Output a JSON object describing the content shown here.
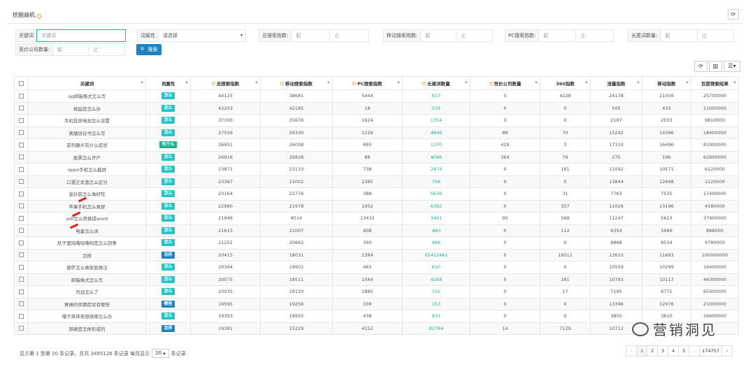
{
  "header": {
    "title": "挖掘商机",
    "hint_glyph": "?",
    "refresh_glyph": "⟳"
  },
  "filters": {
    "keyword": {
      "label": "关键词",
      "placeholder": "关键词"
    },
    "attr": {
      "label": "词属性",
      "value": "请选择",
      "caret": "▾"
    },
    "total": {
      "label": "总搜索指数:",
      "from": "起",
      "to": "止"
    },
    "mobile": {
      "label": "移动搜索指数:",
      "from": "起",
      "to": "止"
    },
    "pc": {
      "label": "PC搜索指数:",
      "from": "起",
      "to": "止"
    },
    "longtail": {
      "label": "长尾词数量:",
      "from": "起",
      "to": "止"
    },
    "bid": {
      "label": "竞价公司数量:",
      "from": "起",
      "to": "止"
    },
    "search_button": "🔍 搜索"
  },
  "toolbar": {
    "refresh": "⟳",
    "columns": "▥",
    "export": "☰▾"
  },
  "columns": [
    "关键词",
    "词属性",
    "总搜索指数",
    "移动搜索指数",
    "PC搜索指数",
    "长尾词数量",
    "竞价公司数量",
    "360指数",
    "流量指数",
    "移动指数",
    "百度搜索结果"
  ],
  "rows": [
    {
      "kw": "qq邮箱格式怎么写",
      "tag": "怎么",
      "tc": "c1",
      "total": "44125",
      "mobile": "38681",
      "pc": "5444",
      "lt": "817",
      "bid": "0",
      "s360": "4228",
      "flow": "24178",
      "mi": "21056",
      "baidu": "25700000"
    },
    {
      "kw": "拖延症怎么办",
      "tag": "怎么",
      "tc": "c1",
      "total": "42203",
      "mobile": "42185",
      "pc": "18",
      "lt": "534",
      "bid": "0",
      "s360": "0",
      "flow": "505",
      "mi": "433",
      "baidu": "11000000"
    },
    {
      "kw": "手机投屏电视怎么设置",
      "tag": "怎么",
      "tc": "c1",
      "total": "37300",
      "mobile": "35676",
      "pc": "1624",
      "lt": "1354",
      "bid": "0",
      "s360": "0",
      "flow": "2197",
      "mi": "2033",
      "baidu": "9810000"
    },
    {
      "kw": "离婚协议书怎么写",
      "tag": "怎么",
      "tc": "c1",
      "total": "27559",
      "mobile": "26330",
      "pc": "1229",
      "lt": "4846",
      "bid": "88",
      "s360": "70",
      "flow": "15242",
      "mi": "14396",
      "baidu": "18400000"
    },
    {
      "kw": "前列腺炎有什么症状",
      "tag": "有什么",
      "tc": "c2",
      "total": "26951",
      "mobile": "26058",
      "pc": "893",
      "lt": "1170",
      "bid": "429",
      "s360": "3",
      "flow": "17310",
      "mi": "16496",
      "baidu": "81900000"
    },
    {
      "kw": "股票怎么开户",
      "tag": "怎么",
      "tc": "c1",
      "total": "26916",
      "mobile": "26828",
      "pc": "88",
      "lt": "4086",
      "bid": "364",
      "s360": "79",
      "flow": "275",
      "mi": "196",
      "baidu": "62900000"
    },
    {
      "kw": "oppo手机怎么截屏",
      "tag": "怎么",
      "tc": "c1",
      "total": "23871",
      "mobile": "23133",
      "pc": "738",
      "lt": "2474",
      "bid": "0",
      "s360": "161",
      "flow": "11092",
      "mi": "10571",
      "baidu": "6120000"
    },
    {
      "kw": "口罩正反面怎么区分",
      "tag": "怎么",
      "tc": "c1",
      "total": "23387",
      "mobile": "21002",
      "pc": "2385",
      "lt": "758",
      "bid": "0",
      "s360": "0",
      "flow": "13844",
      "mi": "12698",
      "baidu": "1120000"
    },
    {
      "kw": "金针菇怎么做好吃",
      "tag": "怎么",
      "tc": "c1",
      "total": "23164",
      "mobile": "22776",
      "pc": "388",
      "lt": "5636",
      "bid": "0",
      "s360": "31",
      "flow": "7763",
      "mi": "7535",
      "baidu": "17400000"
    },
    {
      "kw": "苹果手机怎么录屏",
      "tag": "怎么",
      "tc": "c1",
      "total": "22980",
      "mobile": "21978",
      "pc": "1002",
      "lt": "6382",
      "bid": "0",
      "s360": "357",
      "flow": "11026",
      "mi": "10196",
      "baidu": "4580000"
    },
    {
      "kw": "pdf怎么转换成word",
      "tag": "怎么",
      "tc": "c1",
      "total": "21946",
      "mobile": "8514",
      "pc": "13432",
      "lt": "3461",
      "bid": "95",
      "s360": "568",
      "flow": "11247",
      "mi": "5623",
      "baidu": "37900000"
    },
    {
      "kw": "电量怎么读",
      "tag": "怎么",
      "tc": "c1",
      "total": "21615",
      "mobile": "21007",
      "pc": "608",
      "lt": "480",
      "bid": "0",
      "s360": "112",
      "flow": "6354",
      "mi": "5966",
      "baidu": "888000"
    },
    {
      "kw": "肚子里咕噜咕噜响是怎么回事",
      "tag": "怎么",
      "tc": "c1",
      "total": "21252",
      "mobile": "20862",
      "pc": "390",
      "lt": "486",
      "bid": "0",
      "s360": "0",
      "flow": "8868",
      "mi": "8534",
      "baidu": "9780000"
    },
    {
      "kw": "怎样",
      "tag": "怎样",
      "tc": "c3",
      "total": "20415",
      "mobile": "18031",
      "pc": "2384",
      "lt": "55412461",
      "bid": "0",
      "s360": "19511",
      "flow": "12610",
      "mi": "11693",
      "baidu": "100000000"
    },
    {
      "kw": "披萨怎么做家庭做法",
      "tag": "怎么",
      "tc": "c1",
      "total": "20364",
      "mobile": "19901",
      "pc": "463",
      "lt": "610",
      "bid": "0",
      "s360": "0",
      "flow": "10559",
      "mi": "10299",
      "baidu": "16400000"
    },
    {
      "kw": "邮箱格式怎么写",
      "tag": "怎么",
      "tc": "c1",
      "total": "20075",
      "mobile": "18511",
      "pc": "1564",
      "lt": "4268",
      "bid": "0",
      "s360": "181",
      "flow": "10793",
      "mi": "10117",
      "baidu": "46300000"
    },
    {
      "kw": "肖战怎么了",
      "tag": "怎么",
      "tc": "c1",
      "total": "20035",
      "mobile": "18150",
      "pc": "1885",
      "lt": "722",
      "bid": "0",
      "s360": "17",
      "flow": "7195",
      "mi": "6771",
      "baidu": "65900000"
    },
    {
      "kw": "胃癌的早期症状有哪些",
      "tag": "哪些",
      "tc": "c3",
      "total": "19595",
      "mobile": "19256",
      "pc": "339",
      "lt": "153",
      "bid": "0",
      "s360": "0",
      "flow": "13396",
      "mi": "12976",
      "baidu": "21000000"
    },
    {
      "kw": "嗓子痒痒老想咳嗽怎么办",
      "tag": "怎么",
      "tc": "c1",
      "total": "19393",
      "mobile": "18955",
      "pc": "438",
      "lt": "831",
      "bid": "0",
      "s360": "0",
      "flow": "3850",
      "mi": "3610",
      "baidu": "16600000"
    },
    {
      "kw": "铜锈是怎样形成的",
      "tag": "怎样",
      "tc": "c3",
      "total": "19381",
      "mobile": "15229",
      "pc": "4152",
      "lt": "82784",
      "bid": "14",
      "s360": "7129",
      "flow": "10712",
      "mi": "",
      "baidu": ""
    }
  ],
  "footer": {
    "info_prefix": "显示第 1 到第 20 条记录，总共 3495126 条记录 每页显示",
    "page_size": "20 ▴",
    "info_suffix": "条记录"
  },
  "pager": [
    "‹",
    "1",
    "2",
    "3",
    "4",
    "5",
    "...",
    "174757",
    "›"
  ],
  "watermark": {
    "text": "营销洞见"
  }
}
